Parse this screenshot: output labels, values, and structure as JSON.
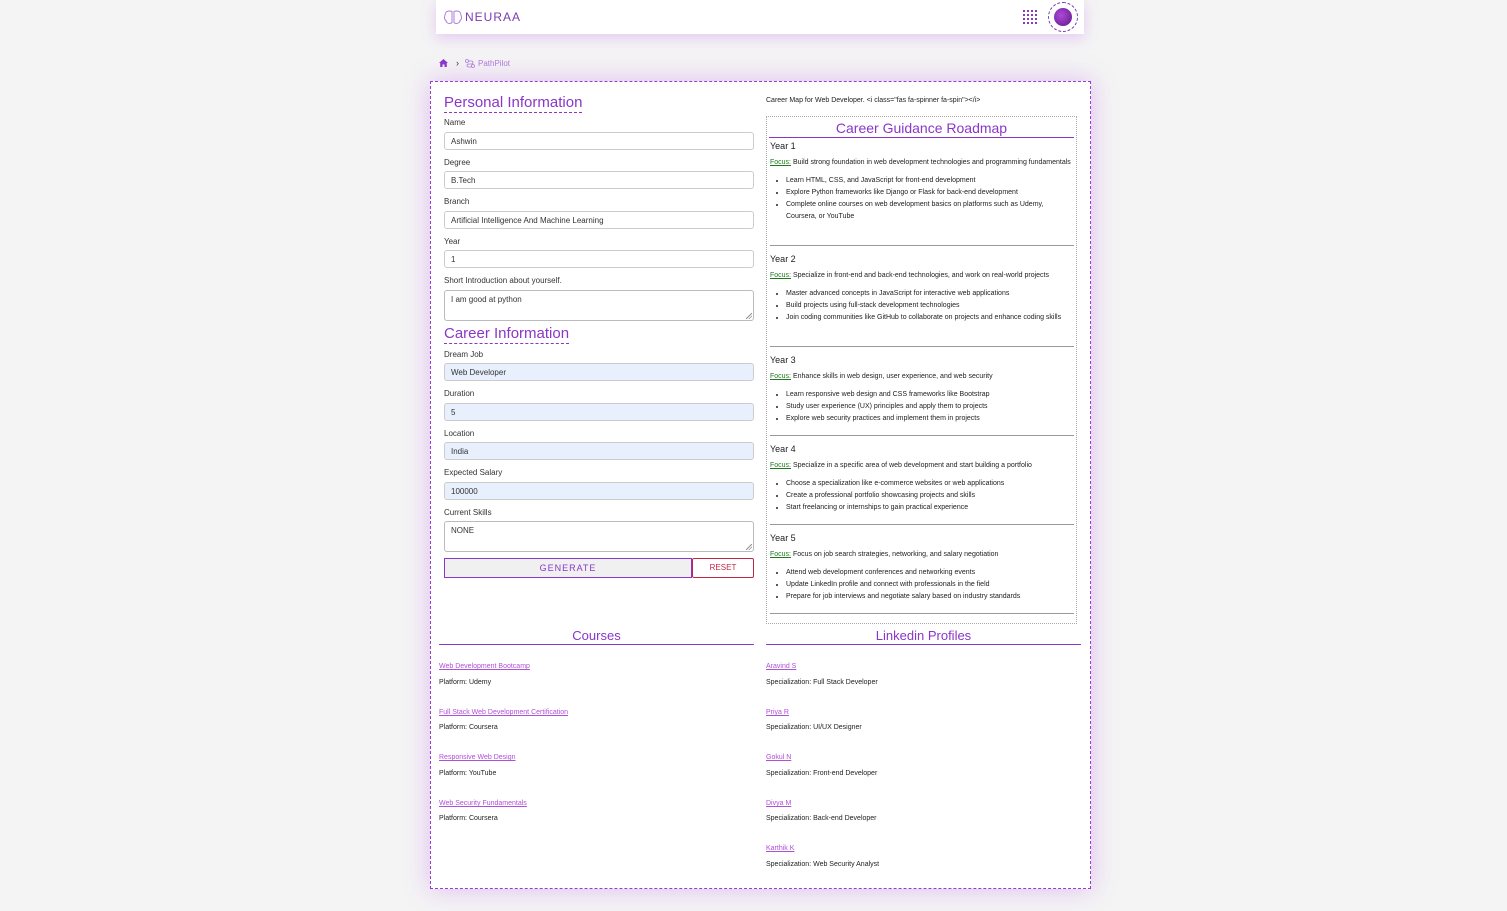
{
  "header": {
    "brand": "NEURAA",
    "apps_icon": "apps-grid-icon",
    "avatar_icon": "avatar"
  },
  "breadcrumb": {
    "home_icon": "home-icon",
    "current": "PathPilot"
  },
  "personal": {
    "title": "Personal Information",
    "name_label": "Name",
    "name_value": "Ashwin",
    "degree_label": "Degree",
    "degree_value": "B.Tech",
    "branch_label": "Branch",
    "branch_value": "Artificial Intelligence And Machine Learning",
    "year_label": "Year",
    "year_value": "1",
    "intro_label": "Short Introduction about yourself.",
    "intro_value": "I am good at python"
  },
  "career": {
    "title": "Career Information",
    "dream_job_label": "Dream Job",
    "dream_job_value": "Web Developer",
    "duration_label": "Duration",
    "duration_value": "5",
    "location_label": "Location",
    "location_value": "India",
    "salary_label": "Expected Salary",
    "salary_value": "100000",
    "skills_label": "Current Skills",
    "skills_value": "NONE",
    "generate_label": "GENERATE",
    "reset_label": "RESET"
  },
  "roadmap": {
    "header_text": "Career Map for Web Developer. <i class=\"fas fa-spinner fa-spin\"></i>",
    "title": "Career Guidance Roadmap",
    "focus_label": "Focus:",
    "years": [
      {
        "title": "Year 1",
        "focus": "Build strong foundation in web development technologies and programming fundamentals",
        "items": [
          "Learn HTML, CSS, and JavaScript for front-end development",
          "Explore Python frameworks like Django or Flask for back-end development",
          "Complete online courses on web development basics on platforms such as Udemy, Coursera, or YouTube"
        ]
      },
      {
        "title": "Year 2",
        "focus": "Specialize in front-end and back-end technologies, and work on real-world projects",
        "items": [
          "Master advanced concepts in JavaScript for interactive web applications",
          "Build projects using full-stack development technologies",
          "Join coding communities like GitHub to collaborate on projects and enhance coding skills"
        ]
      },
      {
        "title": "Year 3",
        "focus": "Enhance skills in web design, user experience, and web security",
        "items": [
          "Learn responsive web design and CSS frameworks like Bootstrap",
          "Study user experience (UX) principles and apply them to projects",
          "Explore web security practices and implement them in projects"
        ]
      },
      {
        "title": "Year 4",
        "focus": "Specialize in a specific area of web development and start building a portfolio",
        "items": [
          "Choose a specialization like e-commerce websites or web applications",
          "Create a professional portfolio showcasing projects and skills",
          "Start freelancing or internships to gain practical experience"
        ]
      },
      {
        "title": "Year 5",
        "focus": "Focus on job search strategies, networking, and salary negotiation",
        "items": [
          "Attend web development conferences and networking events",
          "Update LinkedIn profile and connect with professionals in the field",
          "Prepare for job interviews and negotiate salary based on industry standards"
        ]
      }
    ]
  },
  "courses": {
    "title": "Courses",
    "items": [
      {
        "name": "Web Development Bootcamp",
        "platform": "Platform: Udemy"
      },
      {
        "name": "Full Stack Web Development Certification",
        "platform": "Platform: Coursera"
      },
      {
        "name": "Responsive Web Design",
        "platform": "Platform: YouTube"
      },
      {
        "name": "Web Security Fundamentals",
        "platform": "Platform: Coursera"
      }
    ]
  },
  "linkedin": {
    "title": "Linkedin Profiles",
    "items": [
      {
        "name": "Aravind S",
        "specialization": "Specialization: Full Stack Developer"
      },
      {
        "name": "Priya R",
        "specialization": "Specialization: UI/UX Designer"
      },
      {
        "name": "Gokul N",
        "specialization": "Specialization: Front-end Developer"
      },
      {
        "name": "Divya M",
        "specialization": "Specialization: Back-end Developer"
      },
      {
        "name": "Karthik K",
        "specialization": "Specialization: Web Security Analyst"
      }
    ]
  }
}
